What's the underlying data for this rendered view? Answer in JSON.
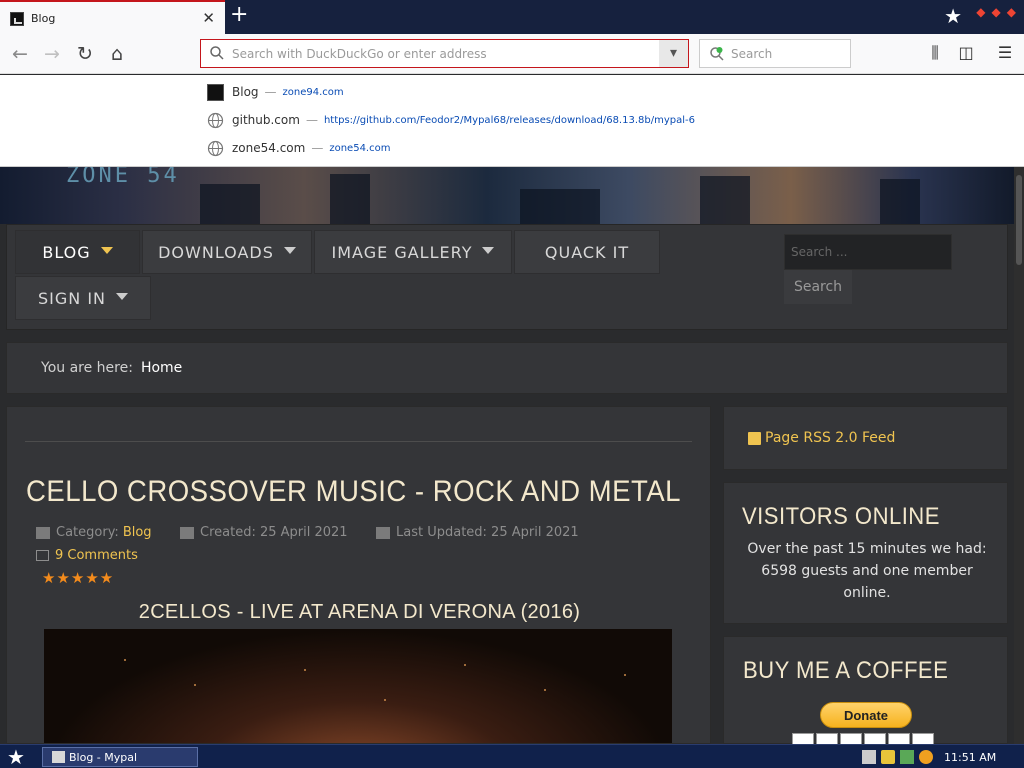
{
  "browser": {
    "tab_title": "Blog",
    "urlbar_placeholder": "Search with DuckDuckGo or enter address",
    "search_placeholder": "Search",
    "suggestions": [
      {
        "name": "Blog",
        "url": "zone94.com"
      },
      {
        "name": "github.com",
        "url": "https://github.com/Feodor2/Mypal68/releases/download/68.13.8b/mypal-6"
      },
      {
        "name": "zone54.com",
        "url": "zone54.com"
      }
    ]
  },
  "site": {
    "logo_text": "ZONE 54",
    "menu": {
      "items": [
        "BLOG",
        "DOWNLOADS",
        "IMAGE GALLERY",
        "QUACK IT",
        "SIGN IN"
      ],
      "search_placeholder": "Search ...",
      "search_button": "Search"
    },
    "breadcrumb": {
      "label": "You are here:",
      "current": "Home"
    },
    "article": {
      "title": "CELLO CROSSOVER MUSIC - ROCK AND METAL",
      "category_label": "Category:",
      "category": "Blog",
      "created": "Created: 25 April 2021",
      "updated": "Last Updated: 25 April 2021",
      "comments": "9 Comments",
      "rating": 5,
      "stars": "★★★★★",
      "video_title": "2CELLOS - LIVE AT ARENA DI VERONA (2016)"
    },
    "sidebar": {
      "rss": "Page RSS 2.0 Feed",
      "visitors_title": "VISITORS ONLINE",
      "visitors_text": "Over the past 15 minutes we had: 6598 guests and one member online.",
      "coffee_title": "BUY ME A COFFEE",
      "donate": "Donate"
    }
  },
  "taskbar": {
    "task_label": "Blog - Mypal",
    "clock": "11:51 AM"
  },
  "colors": {
    "accent": "#f0c450",
    "title": "#f3e8cc",
    "urlbar_border": "#c4161c",
    "panel": "#343538"
  }
}
